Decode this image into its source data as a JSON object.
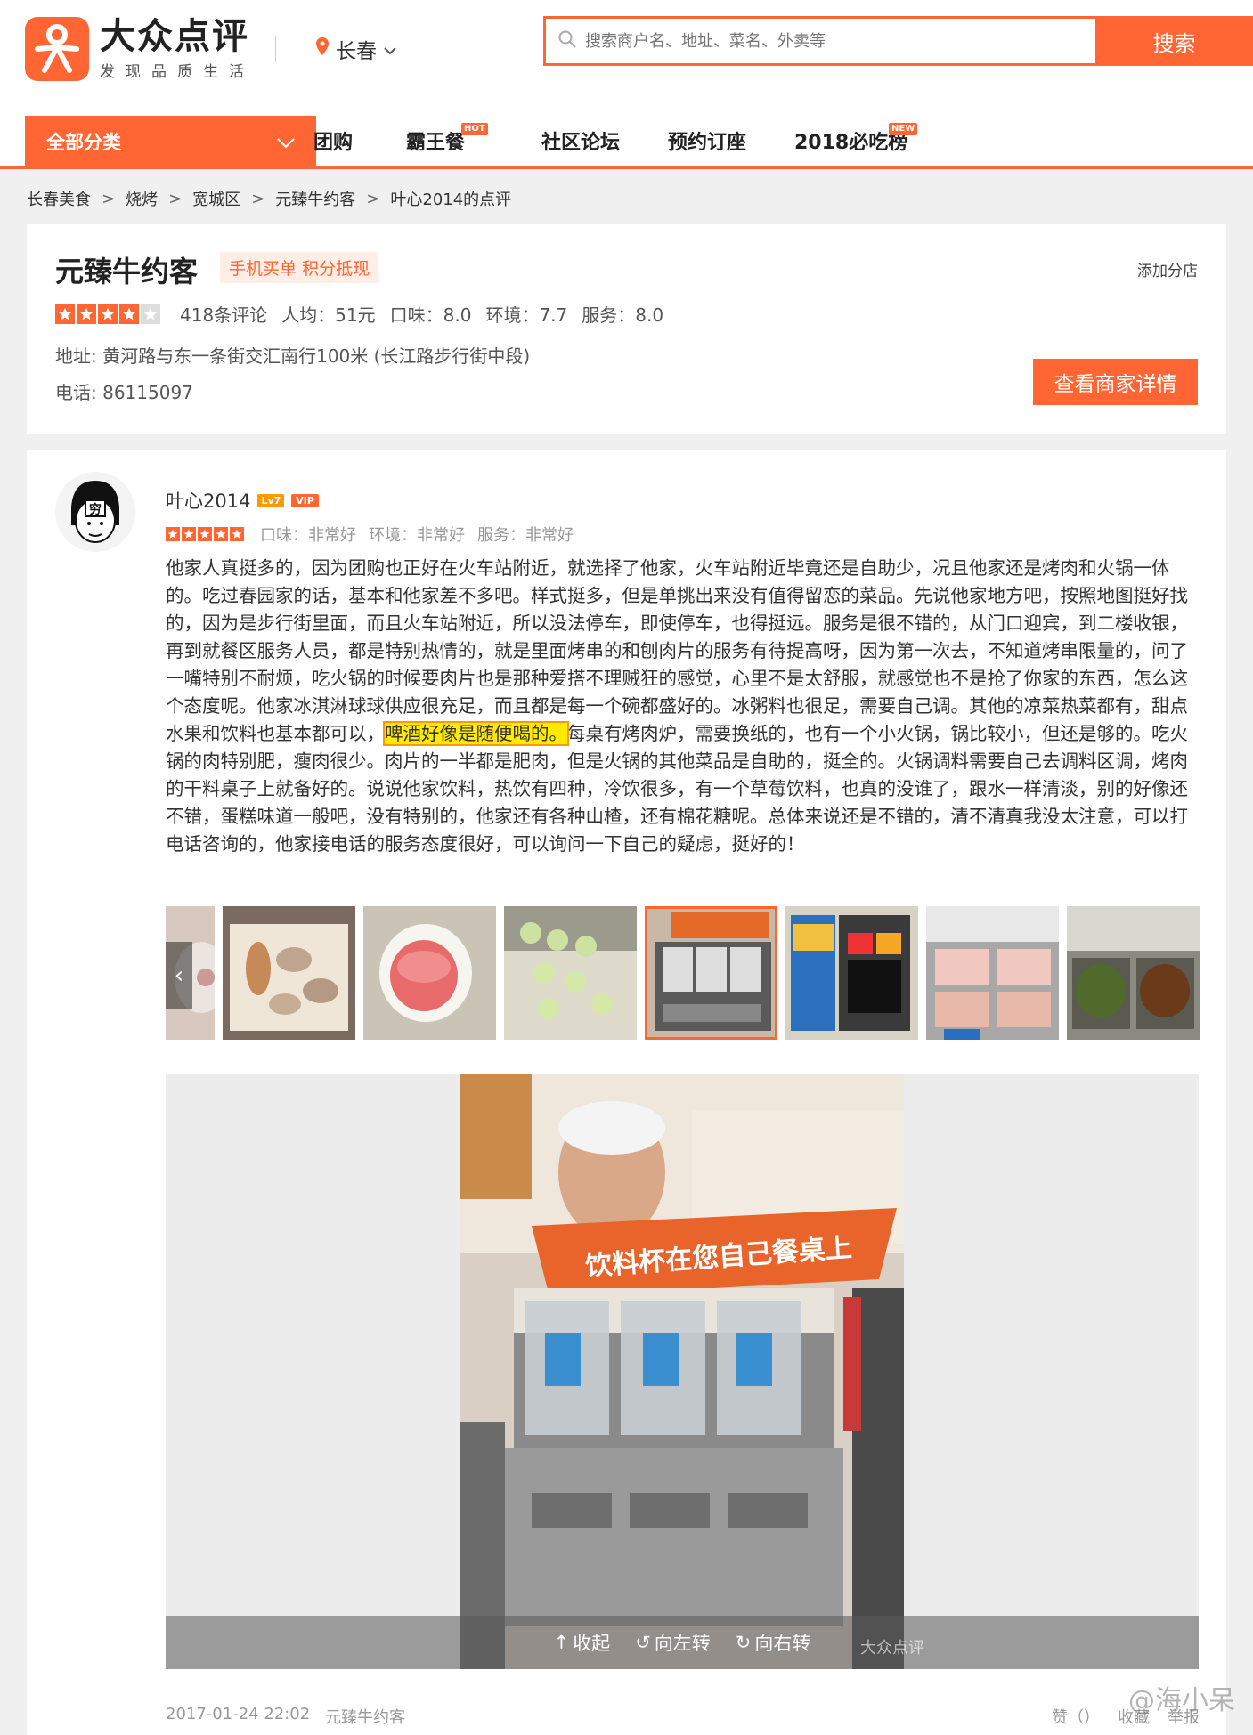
{
  "header": {
    "logo_title": "大众点评",
    "logo_sub": "发现品质生活",
    "city": "长春",
    "search_placeholder": "搜索商户名、地址、菜名、外卖等",
    "search_button": "搜索",
    "all_categories": "全部分类",
    "nav": [
      {
        "label": "团购",
        "tag": ""
      },
      {
        "label": "霸王餐",
        "tag": "HOT"
      },
      {
        "label": "社区论坛",
        "tag": ""
      },
      {
        "label": "预约订座",
        "tag": ""
      },
      {
        "label": "2018必吃榜",
        "tag": "NEW"
      }
    ],
    "accent": "#ff6633"
  },
  "breadcrumb": [
    "长春美食",
    "烧烤",
    "宽城区",
    "元臻牛约客",
    "叶心2014的点评"
  ],
  "shop": {
    "name": "元臻牛约客",
    "promo": "手机买单 积分抵现",
    "add_branch": "添加分店",
    "rating_stars": 4,
    "reviews": "418条评论",
    "avg_price": "人均：51元",
    "taste": "口味：8.0",
    "environment": "环境：7.7",
    "service": "服务：8.0",
    "address": "地址: 黄河路与东一条街交汇南行100米 (长江路步行街中段)",
    "phone": "电话: 86115097",
    "detail_button": "查看商家详情"
  },
  "review": {
    "user": "叶心2014",
    "level": "Lv7",
    "vip": "VIP",
    "rating_stars": 5,
    "taste": "口味：非常好",
    "environment": "环境：非常好",
    "service": "服务：非常好",
    "text_before": "他家人真挺多的，因为团购也正好在火车站附近，就选择了他家，火车站附近毕竟还是自助少，况且他家还是烤肉和火锅一体的。吃过春园家的话，基本和他家差不多吧。样式挺多，但是单挑出来没有值得留恋的菜品。先说他家地方吧，按照地图挺好找的，因为是步行街里面，而且火车站附近，所以没法停车，即使停车，也得挺远。服务是很不错的，从门口迎宾，到二楼收银，再到就餐区服务人员，都是特别热情的，就是里面烤串的和刨肉片的服务有待提高呀，因为第一次去，不知道烤串限量的，问了一嘴特别不耐烦，吃火锅的时候要肉片也是那种爱搭不理贼狂的感觉，心里不是太舒服，就感觉也不是抢了你家的东西，怎么这个态度呢。他家冰淇淋球球供应很充足，而且都是每一个碗都盛好的。冰粥料也很足，需要自己调。其他的凉菜热菜都有，甜点水果和饮料也基本都可以，",
    "text_highlight": "啤酒好像是随便喝的。",
    "text_after": "每桌有烤肉炉，需要换纸的，也有一个小火锅，锅比较小，但还是够的。吃火锅的肉特别肥，瘦肉很少。肉片的一半都是肥肉，但是火锅的其他菜品是自助的，挺全的。火锅调料需要自己去调料区调，烤肉的干料桌子上就备好的。说说他家饮料，热饮有四种，冷饮很多，有一个草莓饮料，也真的没谁了，跟水一样清淡，别的好像还不错，蛋糕味道一般吧，没有特别的，他家还有各种山楂，还有棉花糖呢。总体来说还是不错的，清不清真我没太注意，可以打电话咨询的，他家接电话的服务态度很好，可以询问一下自己的疑虑，挺好的！",
    "viewer_actions": [
      "收起",
      "向左转",
      "向右转"
    ],
    "viewer_watermark": "大众点评",
    "banner_text": "饮料杯在您自己餐桌上",
    "date": "2017-01-24 22:02",
    "shop_link": "元臻牛约客",
    "actions": [
      "赞（）",
      "收藏",
      "举报"
    ]
  },
  "watermark": "@海小呆"
}
